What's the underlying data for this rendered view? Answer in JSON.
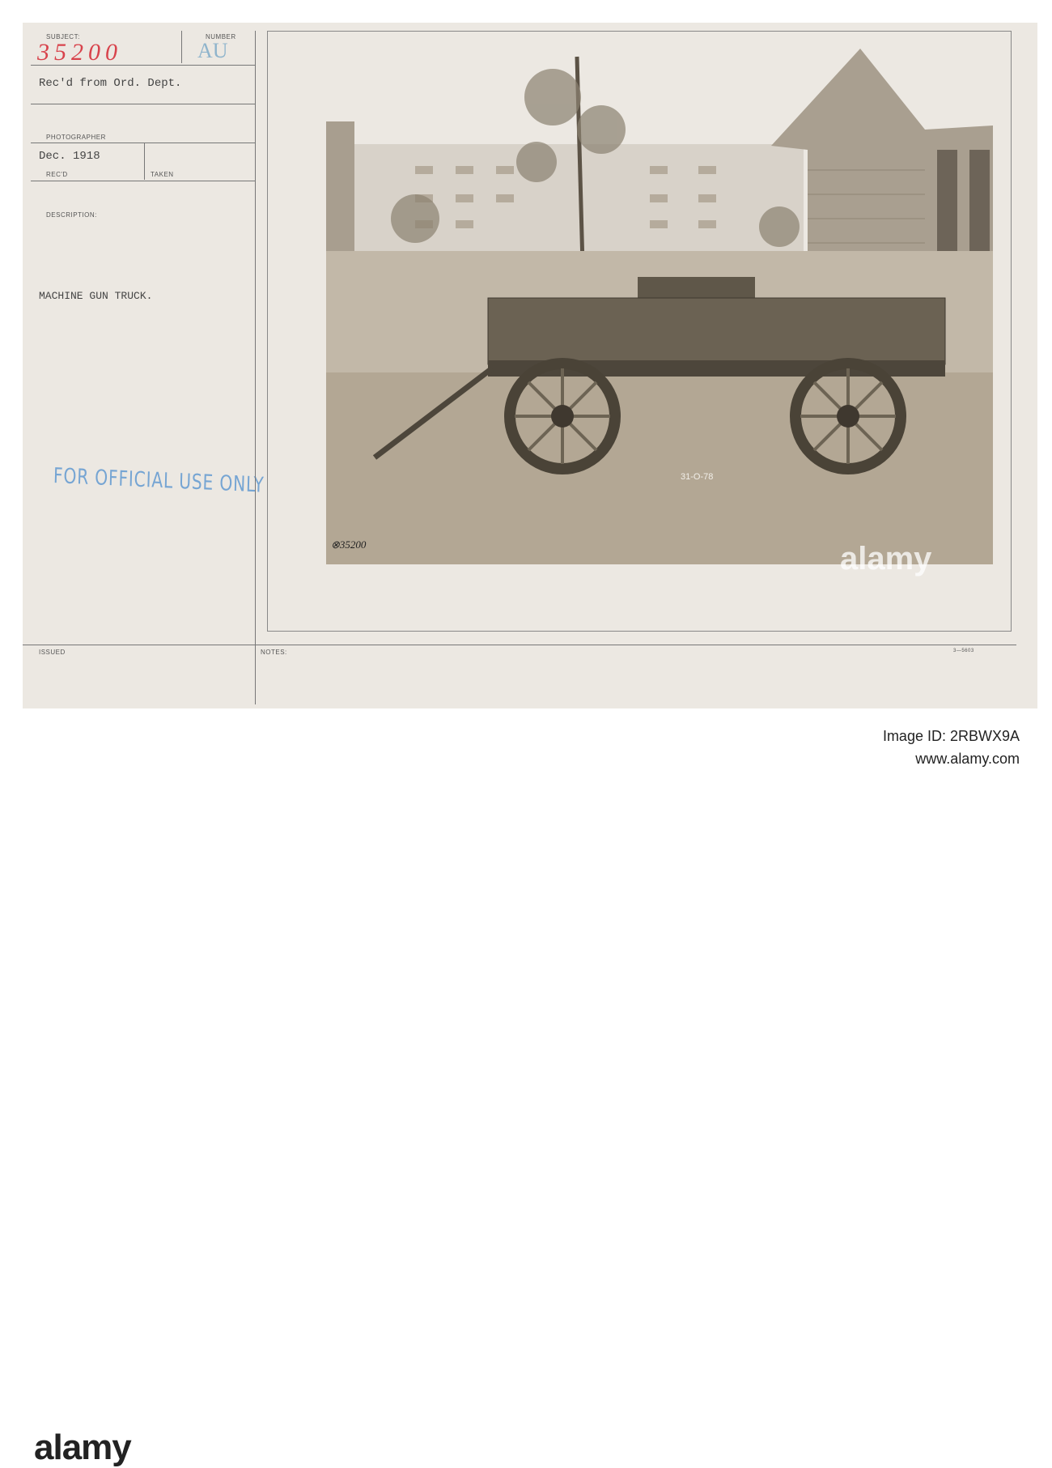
{
  "card": {
    "subject_label": "SUBJECT:",
    "subject_number": "35200",
    "number_label": "NUMBER",
    "number_value": "AU",
    "received_from": "Rec'd from Ord. Dept.",
    "photographer_label": "PHOTOGRAPHER",
    "date_received": "Dec. 1918",
    "recd_label": "REC'D",
    "taken_label": "TAKEN",
    "description_label": "DESCRIPTION:",
    "description": "MACHINE GUN TRUCK.",
    "stamp": "FOR OFFICIAL USE ONLY",
    "issued_label": "ISSUED",
    "notes_label": "NOTES:",
    "form_number": "3—5603"
  },
  "photo": {
    "plate_marking": "31-O-78",
    "negative_number": "⊗35200"
  },
  "watermark": "alamy",
  "footer": {
    "logo": "alamy",
    "image_id": "Image ID: 2RBWX9A",
    "url": "www.alamy.com"
  }
}
